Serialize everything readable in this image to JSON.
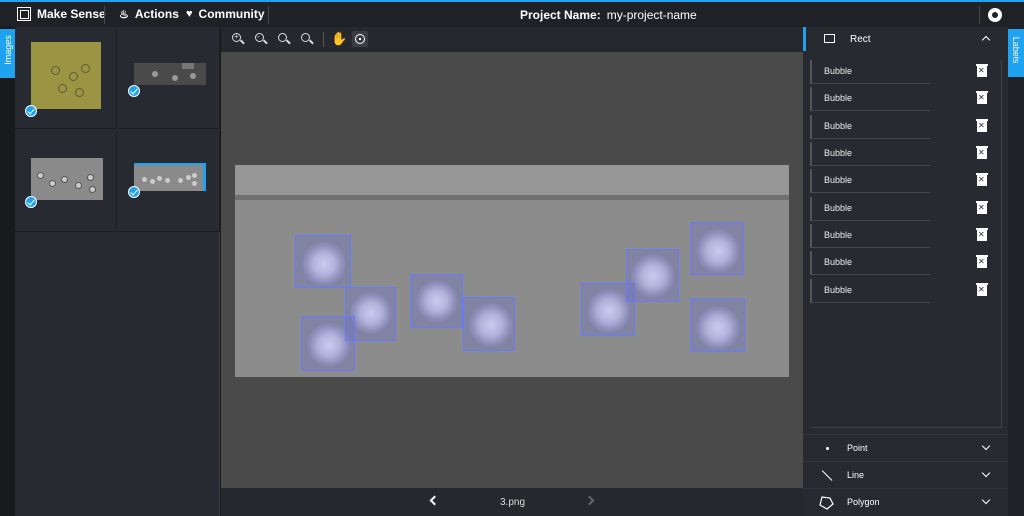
{
  "header": {
    "brand": "Make Sense",
    "actions_label": "Actions",
    "community_label": "Community",
    "project_label": "Project Name:",
    "project_value": "my-project-name",
    "accent_color": "#1fa3f0"
  },
  "left_sidebar": {
    "tab_label": "Images",
    "thumbnails": [
      {
        "name": "image-1",
        "checked": true,
        "selected": false
      },
      {
        "name": "image-2",
        "checked": true,
        "selected": false
      },
      {
        "name": "image-3",
        "checked": true,
        "selected": false
      },
      {
        "name": "image-4",
        "checked": true,
        "selected": true
      }
    ]
  },
  "editor": {
    "toolbar": [
      "zoom-in-icon",
      "zoom-out-icon",
      "zoom-fit-icon",
      "zoom-reset-icon",
      "hand-icon",
      "crosshair-icon"
    ],
    "filename": "3.png",
    "annotation_color": "#6a7aff"
  },
  "right_sidebar": {
    "tab_label": "Labels",
    "active_tool": "Rect",
    "labels": [
      "Bubble",
      "Bubble",
      "Bubble",
      "Bubble",
      "Bubble",
      "Bubble",
      "Bubble",
      "Bubble",
      "Bubble"
    ],
    "tools": [
      "Point",
      "Line",
      "Polygon"
    ]
  }
}
